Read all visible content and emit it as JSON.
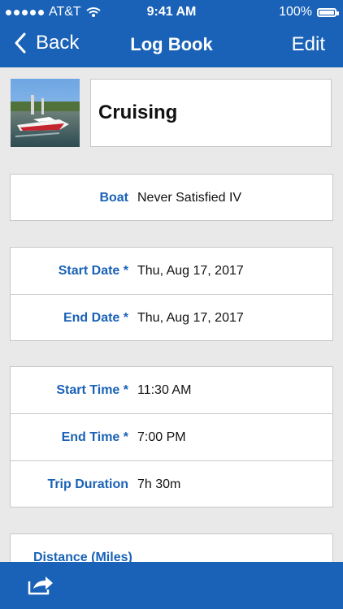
{
  "status_bar": {
    "carrier": "AT&T",
    "time": "9:41 AM",
    "battery": "100%"
  },
  "nav": {
    "back_label": "Back",
    "title": "Log Book",
    "edit_label": "Edit"
  },
  "entry": {
    "title": "Cruising"
  },
  "fields": {
    "boat": {
      "label": "Boat",
      "value": "Never Satisfied IV"
    },
    "start_date": {
      "label": "Start Date *",
      "value": "Thu, Aug 17, 2017"
    },
    "end_date": {
      "label": "End Date *",
      "value": "Thu, Aug 17, 2017"
    },
    "start_time": {
      "label": "Start Time *",
      "value": "11:30 AM"
    },
    "end_time": {
      "label": "End Time *",
      "value": "7:00 PM"
    },
    "trip_duration": {
      "label": "Trip Duration",
      "value": "7h 30m"
    },
    "distance": {
      "label": "Distance (Miles)"
    }
  },
  "colors": {
    "brand_blue": "#1a62b7",
    "background": "#e9e9e9",
    "border": "#c7c7c7"
  },
  "icons": {
    "back": "chevron-left-icon",
    "share": "share-icon",
    "wifi": "wifi-icon",
    "battery": "battery-icon"
  }
}
